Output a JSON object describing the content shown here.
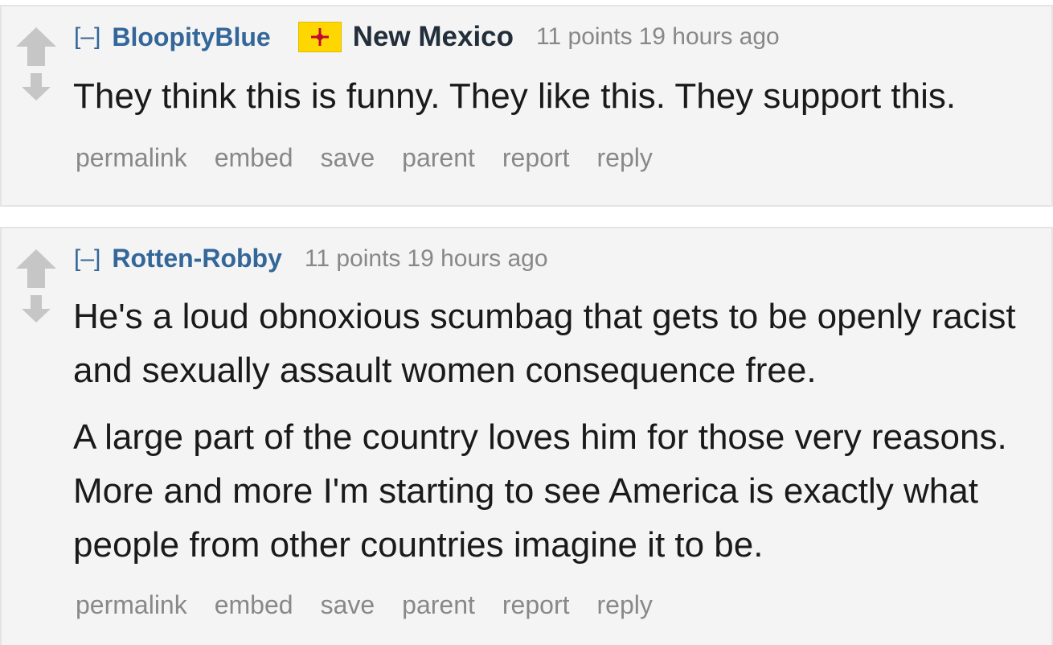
{
  "comments": [
    {
      "expand": "[–]",
      "author": "BloopityBlue",
      "flair": {
        "text": "New Mexico",
        "flag_icon": "new-mexico-flag-icon"
      },
      "score": "11 points",
      "time": "19 hours ago",
      "paragraphs": [
        "They think this is funny. They like this. They support this."
      ],
      "buttons": [
        "permalink",
        "embed",
        "save",
        "parent",
        "report",
        "reply"
      ]
    },
    {
      "expand": "[–]",
      "author": "Rotten-Robby",
      "score": "11 points",
      "time": "19 hours ago",
      "paragraphs": [
        "He's a loud obnoxious scumbag that gets to be openly racist and sexually assault women consequence free.",
        "A large part of the country loves him for those very reasons. More and more I'm starting to see America is exactly what people from other countries imagine it to be."
      ],
      "buttons": [
        "permalink",
        "embed",
        "save",
        "parent",
        "report",
        "reply"
      ]
    }
  ],
  "colors": {
    "link": "#336699",
    "meta": "#888888",
    "comment_bg": "#f4f4f4",
    "vote_arrow": "#c6c6c6",
    "flag_yellow": "#ffd700",
    "flag_red": "#bf0a30"
  }
}
